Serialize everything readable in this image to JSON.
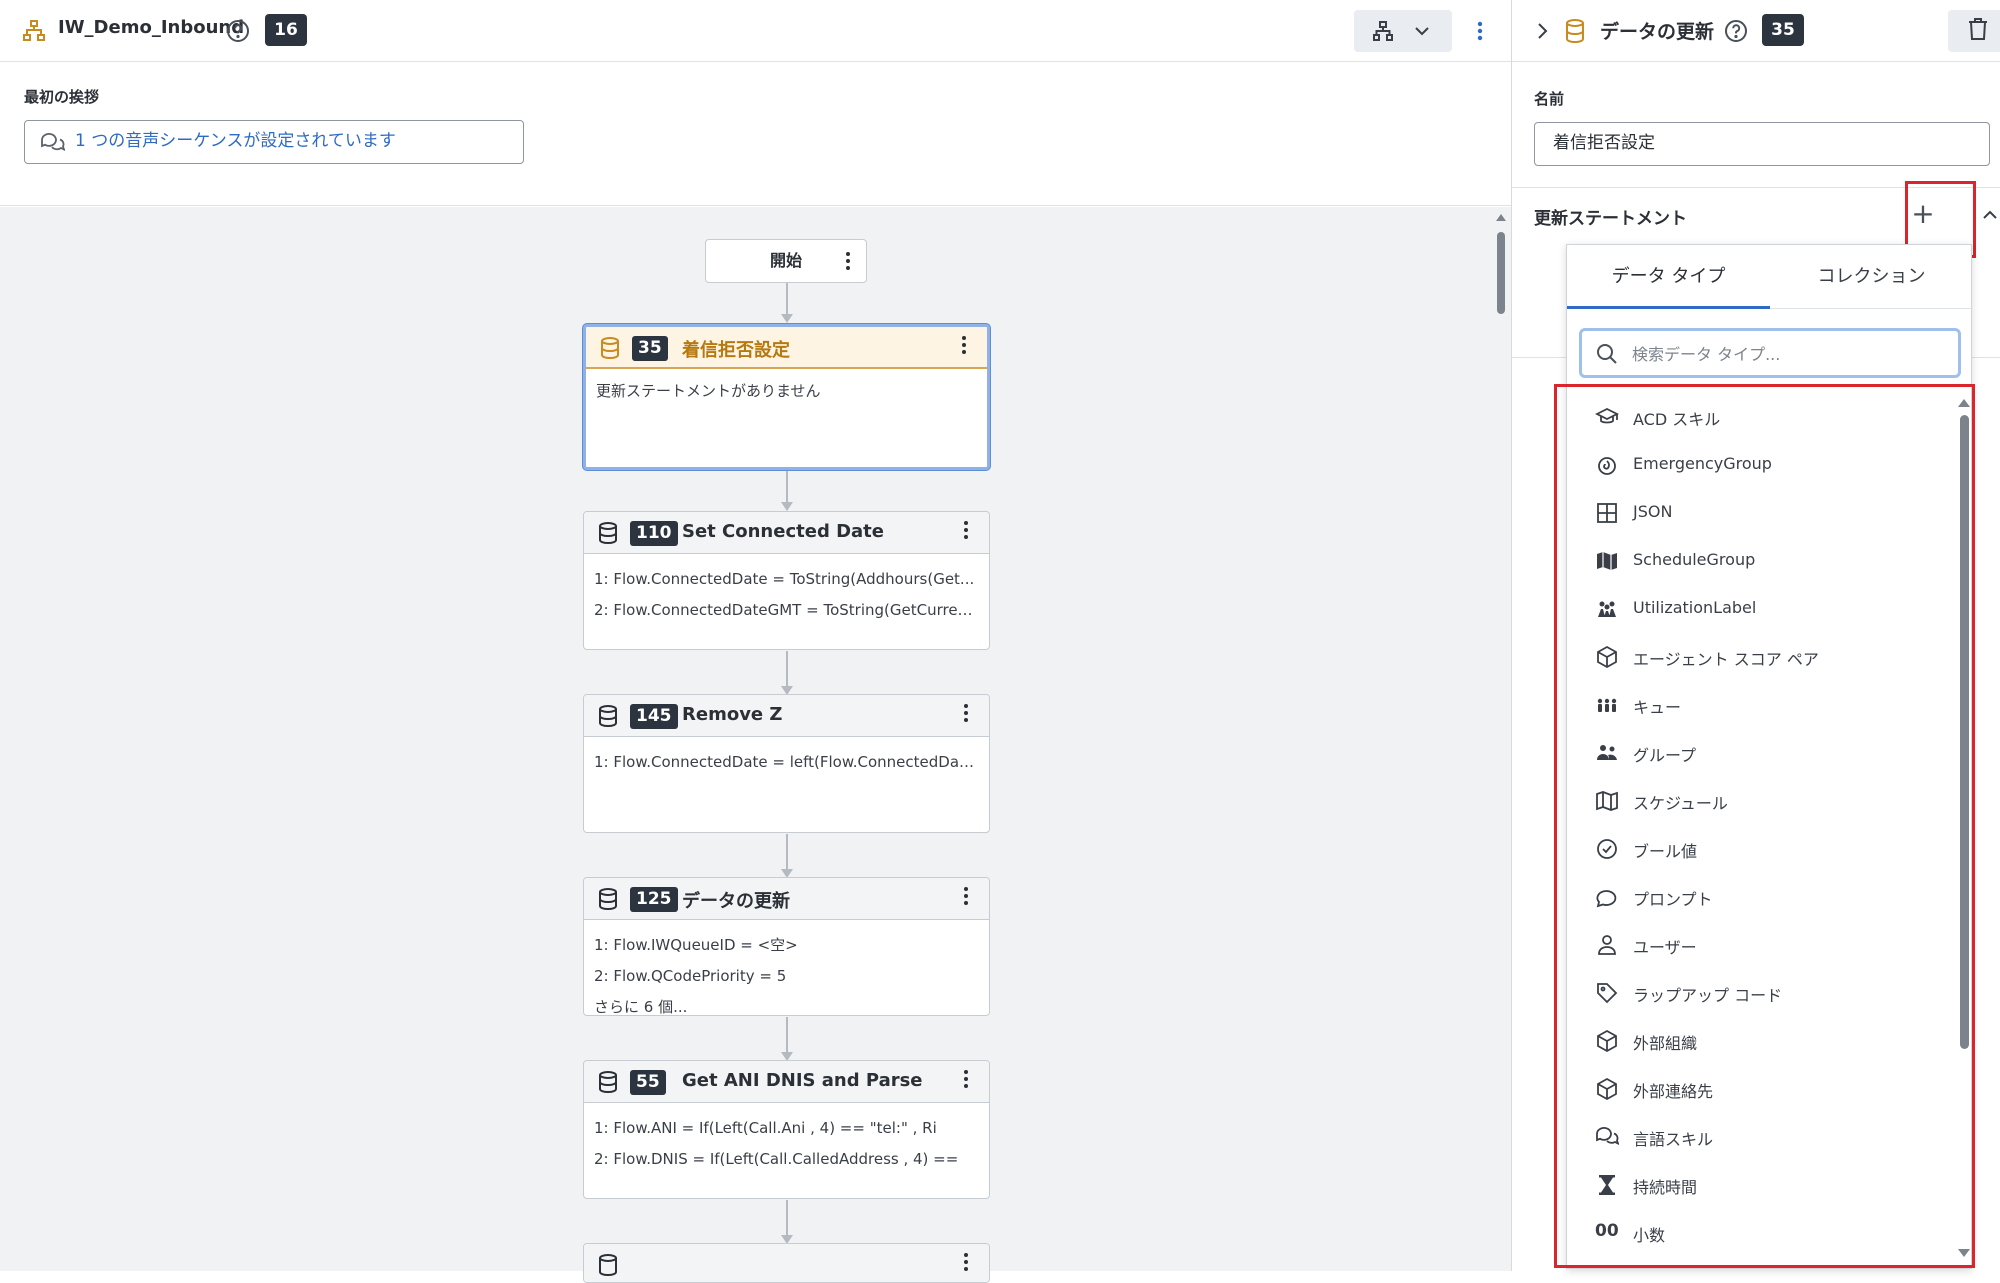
{
  "flow": {
    "title": "IW_Demo_Inbound",
    "badge": "16"
  },
  "greeting": {
    "label": "最初の挨拶",
    "value": "1 つの音声シーケンスが設定されています"
  },
  "start": {
    "label": "開始"
  },
  "nodes": [
    {
      "id": "35",
      "title": "着信拒否設定",
      "lines": [
        "更新ステートメントがありません"
      ]
    },
    {
      "id": "110",
      "title": "Set Connected Date",
      "lines": [
        "1: Flow.ConnectedDate = ToString(Addhours(Get...",
        "2: Flow.ConnectedDateGMT = ToString(GetCurren..."
      ]
    },
    {
      "id": "145",
      "title": "Remove Z",
      "lines": [
        "1: Flow.ConnectedDate = left(Flow.ConnectedDate..."
      ]
    },
    {
      "id": "125",
      "title": "データの更新",
      "lines": [
        "1: Flow.IWQueueID = <空>",
        "2: Flow.QCodePriority = 5",
        "さらに 6 個..."
      ]
    },
    {
      "id": "55",
      "title": "Get ANI DNIS and Parse",
      "lines": [
        "1: Flow.ANI = If(Left(Call.Ani , 4) == \"tel:\" , Ri",
        "2: Flow.DNIS = If(Left(Call.CalledAddress , 4) =="
      ]
    }
  ],
  "panel": {
    "title": "データの更新",
    "badge": "35",
    "name_label": "名前",
    "name_value": "着信拒否設定",
    "statements_label": "更新ステートメント",
    "add_symbol": "+"
  },
  "dropdown": {
    "tabs": [
      "データ タイプ",
      "コレクション"
    ],
    "active_tab": "データ タイプ",
    "search_placeholder": "検索データ タイプ...",
    "items": [
      {
        "label": "ACD スキル",
        "icon": "graduation-cap-icon"
      },
      {
        "label": "EmergencyGroup",
        "icon": "fire-icon"
      },
      {
        "label": "JSON",
        "icon": "grid-icon"
      },
      {
        "label": "ScheduleGroup",
        "icon": "map-filled-icon"
      },
      {
        "label": "UtilizationLabel",
        "icon": "people-tag-icon"
      },
      {
        "label": "エージェント スコア ペア",
        "icon": "cube-icon"
      },
      {
        "label": "キュー",
        "icon": "queue-people-icon"
      },
      {
        "label": "グループ",
        "icon": "group-icon"
      },
      {
        "label": "スケジュール",
        "icon": "map-outline-icon"
      },
      {
        "label": "ブール値",
        "icon": "check-circle-icon"
      },
      {
        "label": "プロンプト",
        "icon": "speech-bubble-icon"
      },
      {
        "label": "ユーザー",
        "icon": "user-icon"
      },
      {
        "label": "ラップアップ コード",
        "icon": "tag-icon"
      },
      {
        "label": "外部組織",
        "icon": "cube-icon"
      },
      {
        "label": "外部連絡先",
        "icon": "cube-icon"
      },
      {
        "label": "言語スキル",
        "icon": "chat-bubbles-icon"
      },
      {
        "label": "持続時間",
        "icon": "hourglass-icon"
      },
      {
        "label": "小数",
        "icon": "decimal-icon"
      }
    ]
  },
  "colors": {
    "accent": "#2f6bc4",
    "highlight": "#d9252b",
    "selected_title": "#b7790f",
    "badge_bg": "#2c3440"
  }
}
